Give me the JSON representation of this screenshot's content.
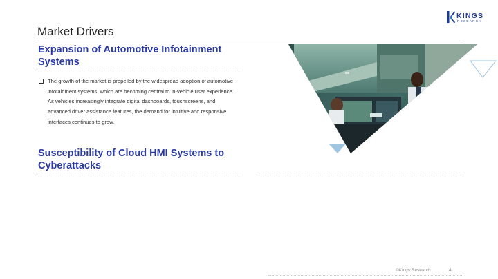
{
  "slide": {
    "title": "Market Drivers",
    "logo": {
      "name": "KINGS",
      "subtitle": "RESEARCH"
    },
    "sections": [
      {
        "heading": "Expansion of Automotive Infotainment Systems",
        "bullet": "The growth of the market is propelled by the widespread adoption of automotive infotainment systems, which are becoming central to in-vehicle user experience. As vehicles increasingly integrate digital dashboards, touchscreens, and advanced driver assistance features, the demand for intuitive and responsive interfaces continues to grow."
      },
      {
        "heading": "Susceptibility of Cloud HMI Systems to Cyberattacks"
      }
    ],
    "footer": {
      "copyright": "©Kings Research",
      "page_number": "4"
    }
  },
  "colors": {
    "heading": "#2b3aa3",
    "logo": "#1f3a93",
    "accent_triangle": "#9fc5e0"
  },
  "image": {
    "subject": "people monitoring traffic and vehicle dashboard screens"
  }
}
